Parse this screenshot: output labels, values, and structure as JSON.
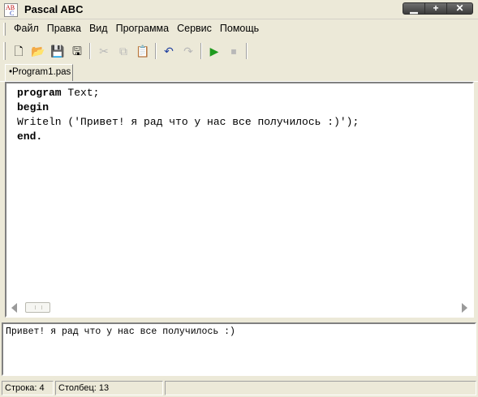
{
  "window": {
    "title": "Pascal ABC",
    "icon": "pascal-abc-app-icon",
    "icon_text_top": "AB",
    "icon_text_bottom": "C",
    "buttons": {
      "minimize": "▁",
      "maximize": "+",
      "close": "✕"
    }
  },
  "menu": {
    "items": [
      "Файл",
      "Правка",
      "Вид",
      "Программа",
      "Сервис",
      "Помощь"
    ]
  },
  "toolbar": {
    "buttons": [
      {
        "name": "new-file-icon",
        "glyph": "🗋",
        "enabled": true
      },
      {
        "name": "open-folder-icon",
        "glyph": "📂",
        "enabled": true
      },
      {
        "name": "save-icon",
        "glyph": "💾",
        "enabled": true
      },
      {
        "name": "save-all-icon",
        "glyph": "🖫",
        "enabled": true
      },
      {
        "name": "cut-icon",
        "glyph": "✂",
        "enabled": false
      },
      {
        "name": "copy-icon",
        "glyph": "⧉",
        "enabled": false
      },
      {
        "name": "paste-icon",
        "glyph": "📋",
        "enabled": true
      },
      {
        "name": "undo-icon",
        "glyph": "↶",
        "enabled": true
      },
      {
        "name": "redo-icon",
        "glyph": "↷",
        "enabled": false
      },
      {
        "name": "run-icon",
        "glyph": "▶",
        "enabled": true
      },
      {
        "name": "stop-icon",
        "glyph": "⏹",
        "enabled": false
      }
    ],
    "run_color": "#1f9a1f"
  },
  "tabs": [
    {
      "label": "•Program1.pas",
      "active": true
    }
  ],
  "editor": {
    "lines": [
      {
        "kw": "program",
        "rest": " Text;"
      },
      {
        "kw": "begin",
        "rest": ""
      },
      {
        "kw": "",
        "rest": "Writeln ('Привет! я рад что у нас все получилось :)');"
      },
      {
        "kw": "end.",
        "rest": ""
      }
    ]
  },
  "output": {
    "text": "Привет! я рад что у нас все получилось :)"
  },
  "status": {
    "line": "Строка: 4",
    "column": "Столбец: 13",
    "extra": ""
  }
}
